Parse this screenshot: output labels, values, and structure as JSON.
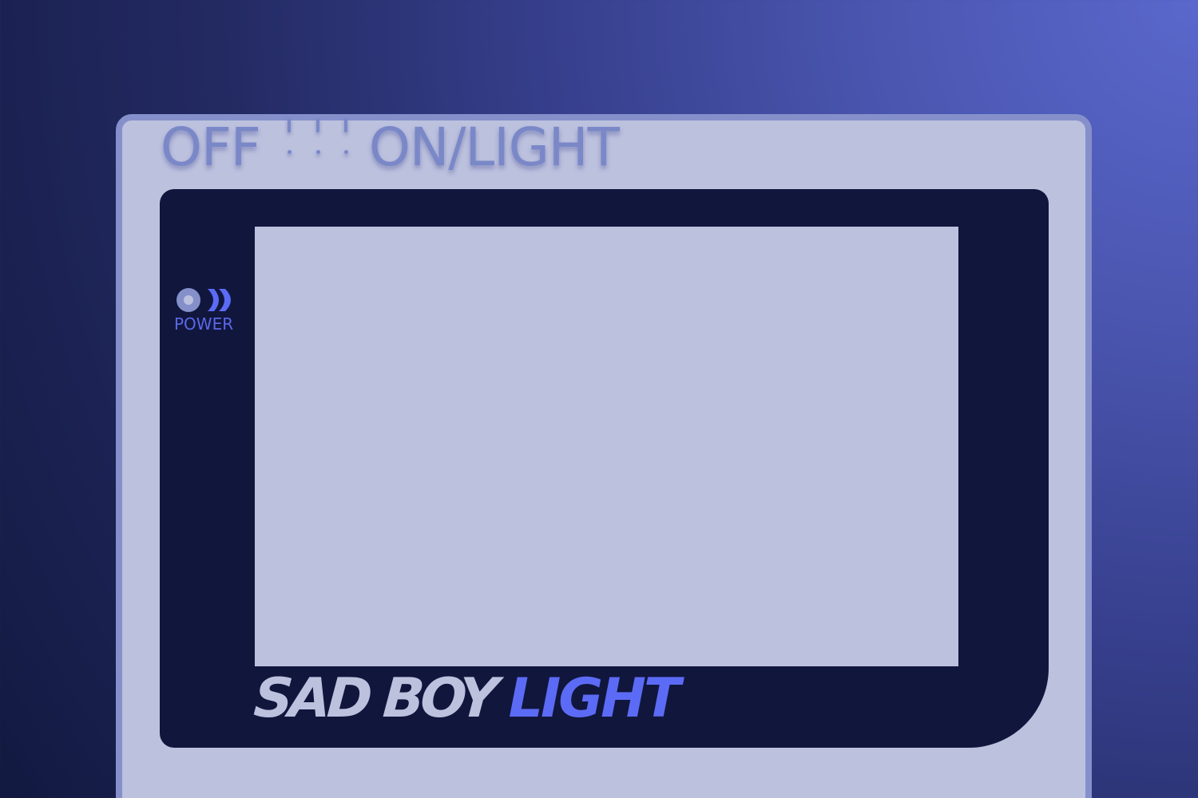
{
  "device": {
    "switch": {
      "off_label": "OFF",
      "on_label": "ON/LIGHT"
    },
    "power_indicator": {
      "label": "POWER",
      "icon": "power-led-icon"
    },
    "brand": {
      "main": "SAD BOY",
      "accent": "LIGHT"
    },
    "colors": {
      "body": "#bcc1de",
      "body_border": "#8590cb",
      "bezel": "#11163d",
      "screen": "#bcc1de",
      "accent": "#5c6bf5",
      "switch_text": "#7a88c8"
    }
  }
}
